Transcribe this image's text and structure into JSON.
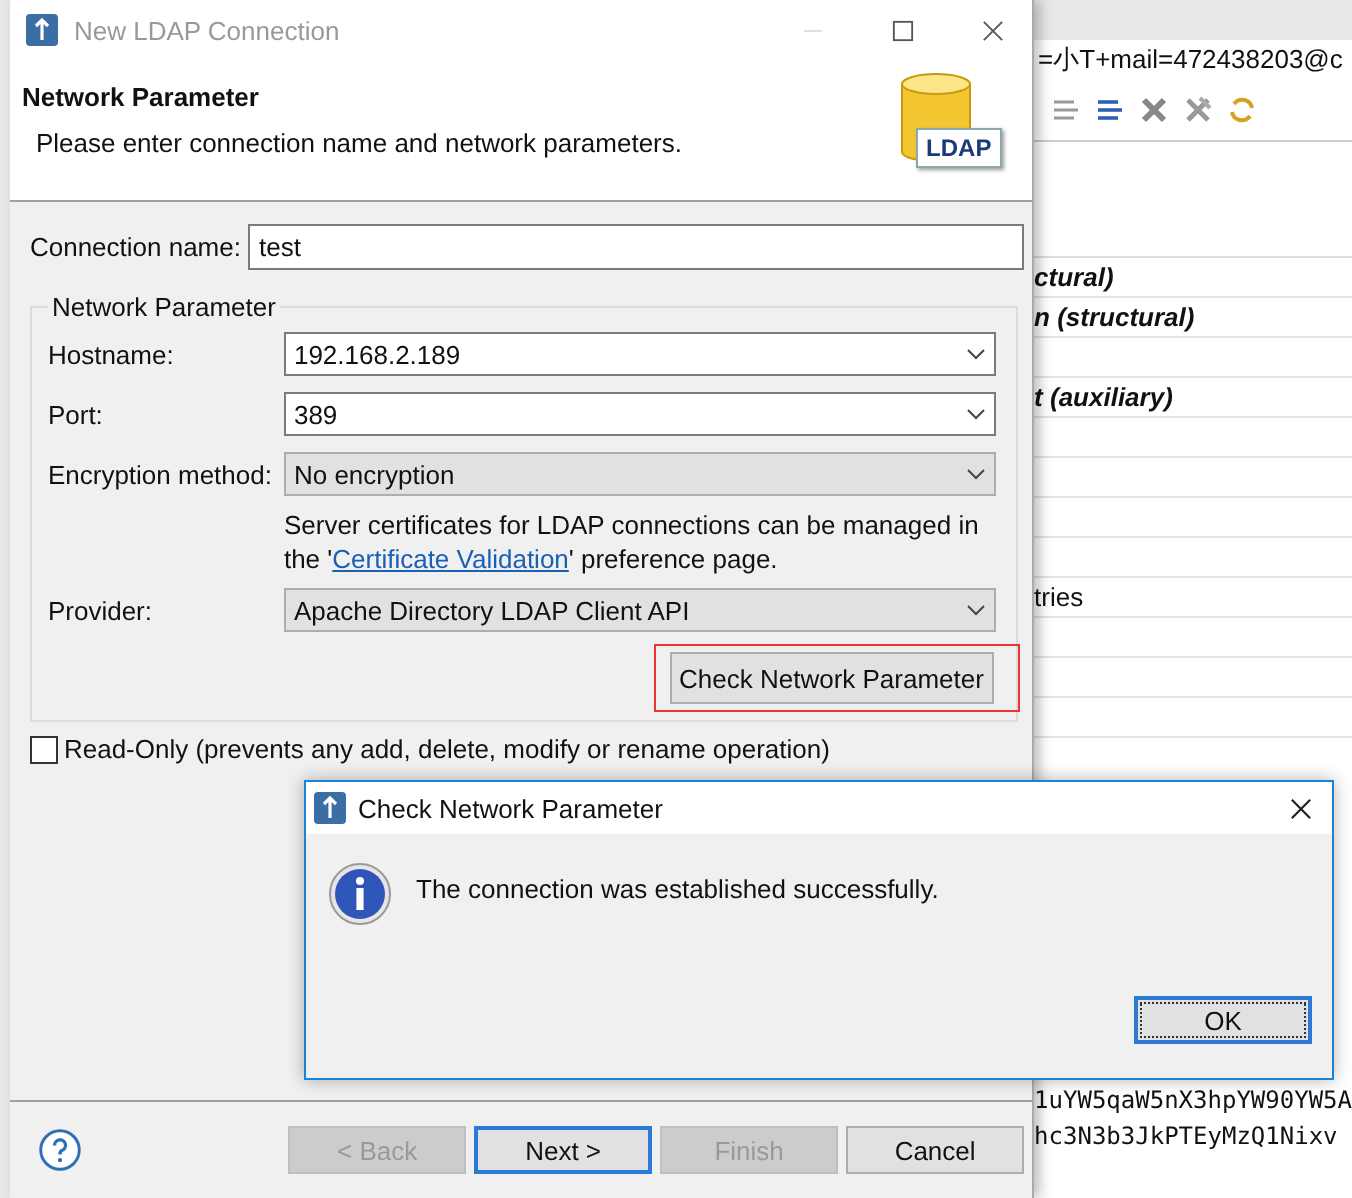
{
  "background_window": {
    "dn_fragment": "=小T+mail=472438203@c",
    "table_rows": [
      {
        "text": "ctural)",
        "emphasis": true
      },
      {
        "text": "n (structural)",
        "emphasis": true
      },
      {},
      {
        "text": "t (auxiliary)",
        "emphasis": true
      },
      {},
      {},
      {},
      {},
      {
        "text": "tries",
        "emphasis": false
      },
      {},
      {},
      {}
    ],
    "value_lines": [
      "1uYW5qaW5nX3hpYW90YW5A",
      "hc3N3b3JkPTEyMzQ1Nixv"
    ]
  },
  "dialog": {
    "title": "New LDAP Connection",
    "active": false,
    "page_title": "Network Parameter",
    "page_description": "Please enter connection name and network parameters.",
    "logo_label": "LDAP",
    "connection_name": {
      "label": "Connection name:",
      "value": "test"
    },
    "group": {
      "title": "Network Parameter",
      "fields": [
        {
          "label": "Hostname:",
          "value": "192.168.2.189",
          "editable": true
        },
        {
          "label": "Port:",
          "value": "389",
          "editable": true
        },
        {
          "label": "Encryption method:",
          "value": "No encryption",
          "editable": false
        }
      ],
      "note": {
        "before": "Server certificates for LDAP connections can be managed in the '",
        "link": "Certificate Validation",
        "after": "' preference page."
      },
      "provider": {
        "label": "Provider:",
        "value": "Apache Directory LDAP Client API",
        "editable": false
      },
      "check_button": {
        "label": "Check Network Parameter",
        "highlighted": true
      }
    },
    "read_only": {
      "label": "Read-Only (prevents any add, delete, modify or rename operation)",
      "checked": false
    },
    "buttons": [
      {
        "label": "< Back",
        "disabled": true,
        "default": false
      },
      {
        "label": "Next >",
        "disabled": false,
        "default": true
      },
      {
        "label": "Finish",
        "disabled": true,
        "default": false
      },
      {
        "label": "Cancel",
        "disabled": false,
        "default": false
      }
    ]
  },
  "message_box": {
    "title": "Check Network Parameter",
    "message": "The connection was established successfully.",
    "button": "OK"
  }
}
